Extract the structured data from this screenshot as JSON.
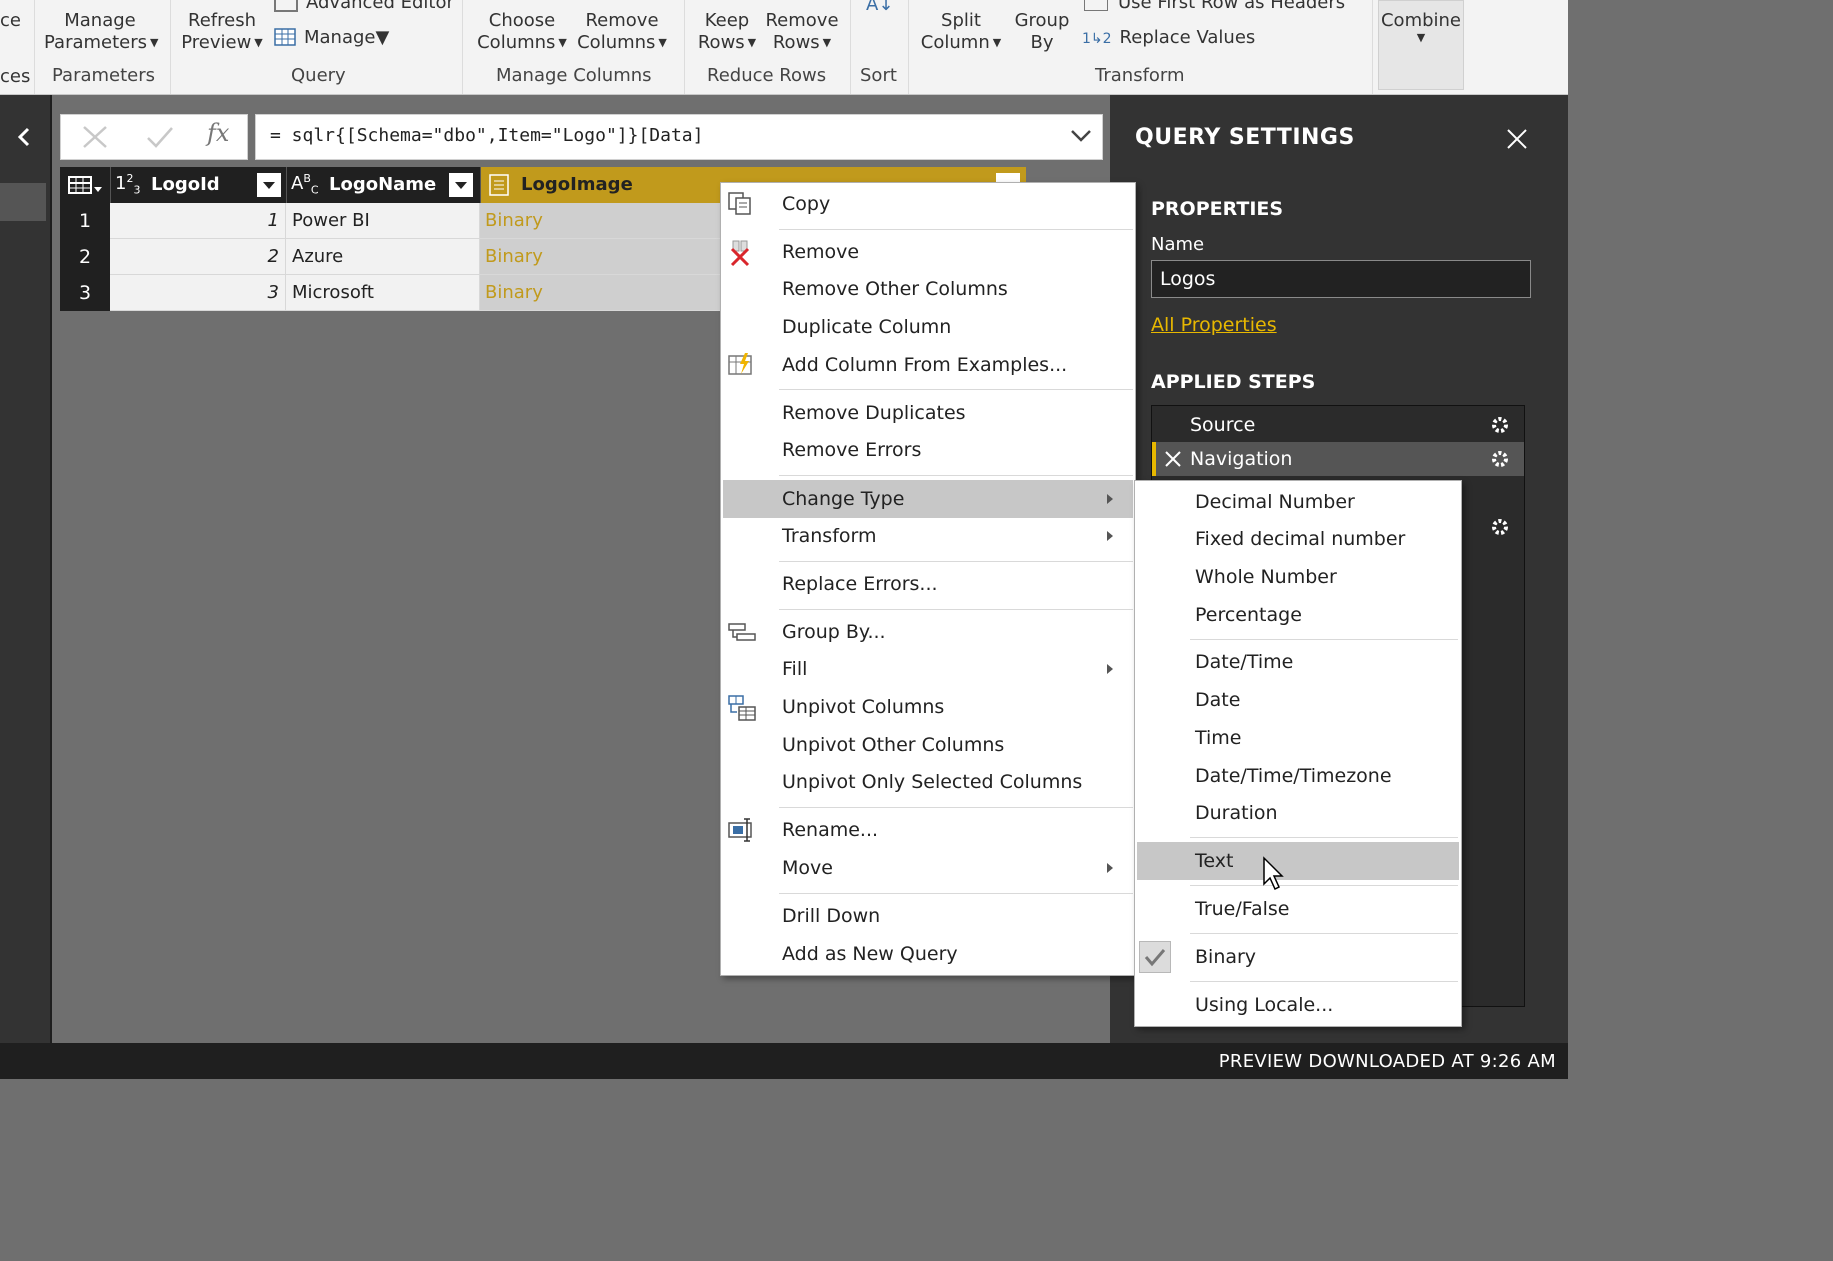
{
  "ribbon": {
    "left_cut_top": "ce",
    "left_cut_bottom": "ces",
    "manage_params_line1": "Manage",
    "manage_params_line2": "Parameters",
    "refresh_line1": "Refresh",
    "refresh_line2": "Preview",
    "advanced_editor": "Advanced Editor",
    "manage": "Manage",
    "choose_cols_line1": "Choose",
    "choose_cols_line2": "Columns",
    "remove_cols_line1": "Remove",
    "remove_cols_line2": "Columns",
    "keep_rows_line1": "Keep",
    "keep_rows_line2": "Rows",
    "remove_rows_line1": "Remove",
    "remove_rows_line2": "Rows",
    "split_line1": "Split",
    "split_line2": "Column",
    "group_line1": "Group",
    "group_line2": "By",
    "use_first_row": "Use First Row as Headers",
    "replace_values": "Replace Values",
    "combine": "Combine",
    "groups": {
      "parameters": "Parameters",
      "query": "Query",
      "manage_columns": "Manage Columns",
      "reduce_rows": "Reduce Rows",
      "sort": "Sort",
      "transform": "Transform"
    }
  },
  "formula_bar": {
    "fx": "fx",
    "formula": "= sqlr{[Schema=\"dbo\",Item=\"Logo\"]}[Data]"
  },
  "table": {
    "columns": [
      {
        "type_icon": "1²₃",
        "name": "LogoId"
      },
      {
        "type_icon": "AᴮC",
        "name": "LogoName"
      },
      {
        "type_icon": "binary",
        "name": "LogoImage"
      }
    ],
    "rows": [
      {
        "num": "1",
        "id": "1",
        "name": "Power BI",
        "image": "Binary"
      },
      {
        "num": "2",
        "id": "2",
        "name": "Azure",
        "image": "Binary"
      },
      {
        "num": "3",
        "id": "3",
        "name": "Microsoft",
        "image": "Binary"
      }
    ]
  },
  "query_settings": {
    "title": "QUERY SETTINGS",
    "properties_header": "PROPERTIES",
    "name_label": "Name",
    "name_value": "Logos",
    "all_properties": "All Properties",
    "applied_steps_header": "APPLIED STEPS",
    "steps": [
      "Source",
      "Navigation"
    ]
  },
  "context_menu": {
    "items": {
      "copy": "Copy",
      "remove": "Remove",
      "remove_other_columns": "Remove Other Columns",
      "duplicate_column": "Duplicate Column",
      "add_column_from_examples": "Add Column From Examples...",
      "remove_duplicates": "Remove Duplicates",
      "remove_errors": "Remove Errors",
      "change_type": "Change Type",
      "transform": "Transform",
      "replace_errors": "Replace Errors...",
      "group_by": "Group By...",
      "fill": "Fill",
      "unpivot_columns": "Unpivot Columns",
      "unpivot_other_columns": "Unpivot Other Columns",
      "unpivot_only_selected": "Unpivot Only Selected Columns",
      "rename": "Rename...",
      "move": "Move",
      "drill_down": "Drill Down",
      "add_as_new_query": "Add as New Query"
    }
  },
  "change_type_submenu": {
    "items": {
      "decimal": "Decimal Number",
      "fixed_decimal": "Fixed decimal number",
      "whole": "Whole Number",
      "percentage": "Percentage",
      "datetime": "Date/Time",
      "date": "Date",
      "time": "Time",
      "datetimezone": "Date/Time/Timezone",
      "duration": "Duration",
      "text": "Text",
      "truefalse": "True/False",
      "binary": "Binary",
      "using_locale": "Using Locale..."
    },
    "checked": "Binary",
    "hovered": "Text"
  },
  "status_bar": {
    "text": "PREVIEW DOWNLOADED AT 9:26 AM"
  },
  "colors": {
    "accent": "#c19a1c",
    "link": "#e8b800",
    "pane": "#333333",
    "canvas": "#6f6f6f"
  }
}
